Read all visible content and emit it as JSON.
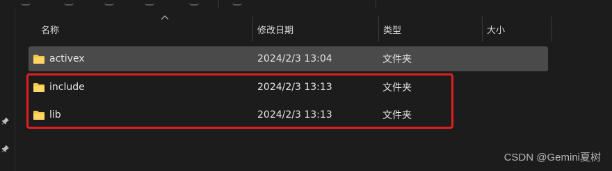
{
  "columns": {
    "name": "名称",
    "date_modified": "修改日期",
    "type": "类型",
    "size": "大小"
  },
  "files": [
    {
      "name": "activex",
      "date": "2024/2/3 13:04",
      "type": "文件夹",
      "icon": "folder-icon",
      "selected": true
    },
    {
      "name": "include",
      "date": "2024/2/3 13:13",
      "type": "文件夹",
      "icon": "folder-icon",
      "selected": false
    },
    {
      "name": "lib",
      "date": "2024/2/3 13:13",
      "type": "文件夹",
      "icon": "folder-icon",
      "selected": false
    }
  ],
  "watermark": "CSDN @Gemini夏树",
  "colors": {
    "background": "#1c1c1c",
    "selected_row": "#4a4a4a",
    "highlight_box": "#e02020",
    "folder": "#f4c542"
  }
}
